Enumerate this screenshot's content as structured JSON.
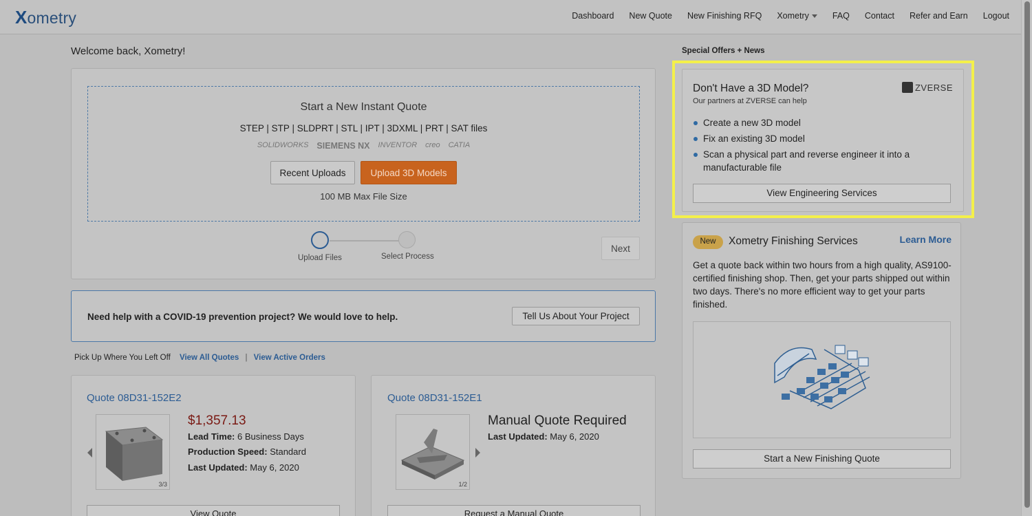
{
  "nav": {
    "logo": "ometry",
    "logo_x": "X",
    "links": [
      "Dashboard",
      "New Quote",
      "New Finishing RFQ",
      "Xometry",
      "FAQ",
      "Contact",
      "Refer and Earn",
      "Logout"
    ]
  },
  "welcome": "Welcome back, Xometry!",
  "upload": {
    "title": "Start a New Instant Quote",
    "formats": "STEP | STP | SLDPRT | STL | IPT | 3DXML | PRT | SAT files",
    "cad_logos": [
      "SOLIDWORKS",
      "SIEMENS NX",
      "INVENTOR",
      "creo",
      "CATIA"
    ],
    "recent_label": "Recent Uploads",
    "upload_label": "Upload 3D Models",
    "max_size": "100 MB Max File Size",
    "steps": [
      "Upload Files",
      "Select Process"
    ],
    "next_label": "Next"
  },
  "covid": {
    "text": "Need help with a COVID-19 prevention project? We would love to help.",
    "button": "Tell Us About Your Project"
  },
  "pickup": {
    "label": "Pick Up Where You Left Off",
    "view_quotes": "View All Quotes",
    "separator": "|",
    "view_orders": "View Active Orders"
  },
  "quotes": [
    {
      "title": "Quote 08D31-152E2",
      "price": "$1,357.13",
      "lead_label": "Lead Time:",
      "lead_value": "6 Business Days",
      "speed_label": "Production Speed:",
      "speed_value": "Standard",
      "updated_label": "Last Updated:",
      "updated_value": "May 6, 2020",
      "counter": "3/3",
      "button": "View Quote"
    },
    {
      "title": "Quote 08D31-152E1",
      "status": "Manual Quote Required",
      "updated_label": "Last Updated:",
      "updated_value": "May 6, 2020",
      "counter": "1/2",
      "button": "Request a Manual Quote"
    }
  ],
  "special": {
    "label": "Special Offers + News",
    "zverse": {
      "title": "Don't Have a 3D Model?",
      "subtitle": "Our partners at ZVERSE can help",
      "logo": "ZVERSE",
      "items": [
        "Create a new 3D model",
        "Fix an existing 3D model",
        "Scan a physical part and reverse engineer it into a manufacturable file"
      ],
      "button": "View Engineering Services"
    },
    "finishing": {
      "badge": "New",
      "title": "Xometry Finishing Services",
      "learn_more": "Learn More",
      "description": "Get a quote back within two hours from a high quality, AS9100-certified finishing shop. Then, get your parts shipped out within two days. There's no more efficient way to get your parts finished.",
      "button": "Start a New Finishing Quote"
    }
  },
  "colors": {
    "accent_blue": "#2c5c93",
    "highlight": "#f4f04a",
    "upload_orange": "#c8631e",
    "price_red": "#7a1a14"
  }
}
